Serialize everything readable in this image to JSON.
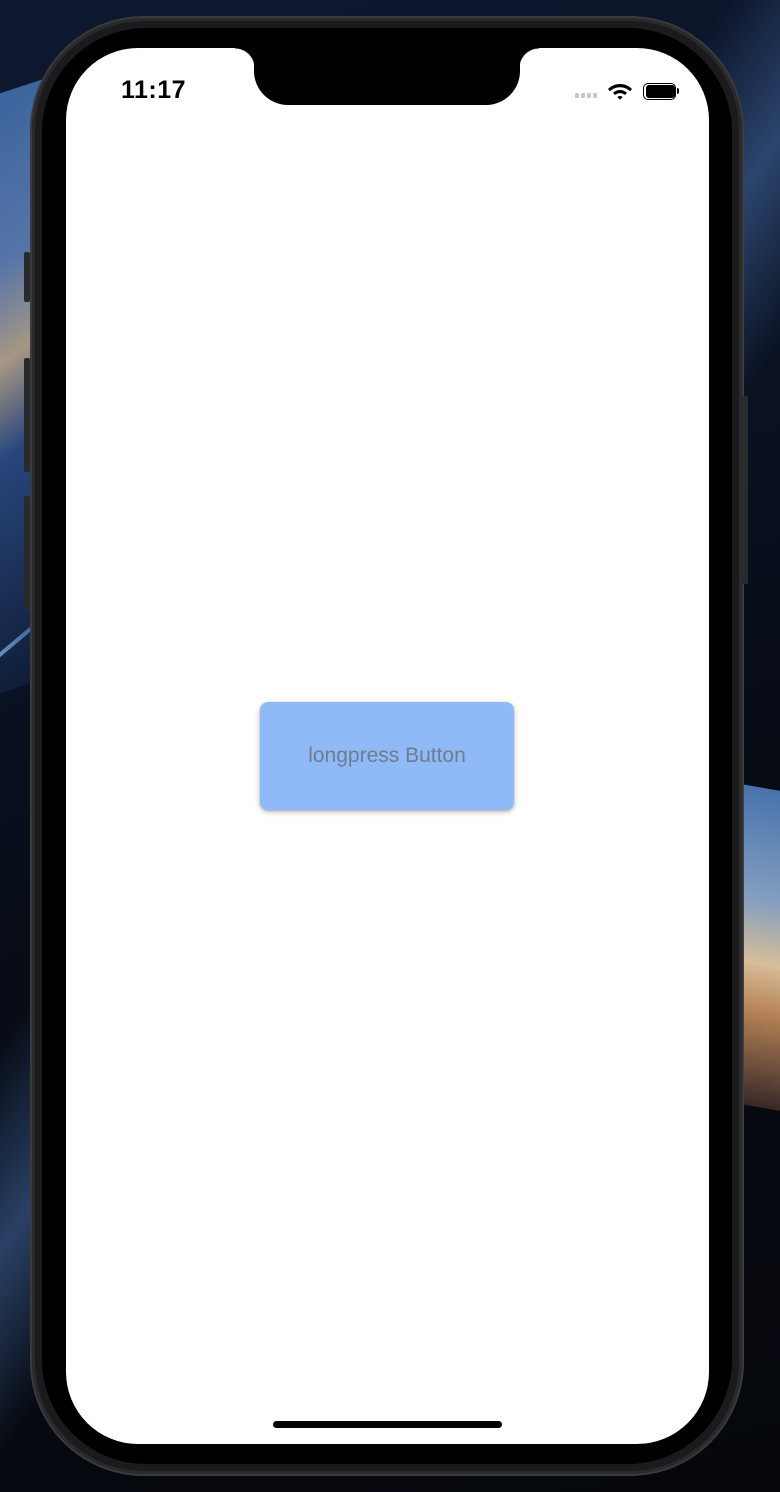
{
  "status_bar": {
    "time": "11:17",
    "icons": [
      "cellular-signal-icon",
      "wifi-icon",
      "battery-icon"
    ]
  },
  "main": {
    "button_label": "longpress Button"
  },
  "colors": {
    "button_background": "#8fbaf7",
    "button_text": "#6f7c8f",
    "screen_background": "#ffffff",
    "device_frame": "#1b1b1d"
  }
}
